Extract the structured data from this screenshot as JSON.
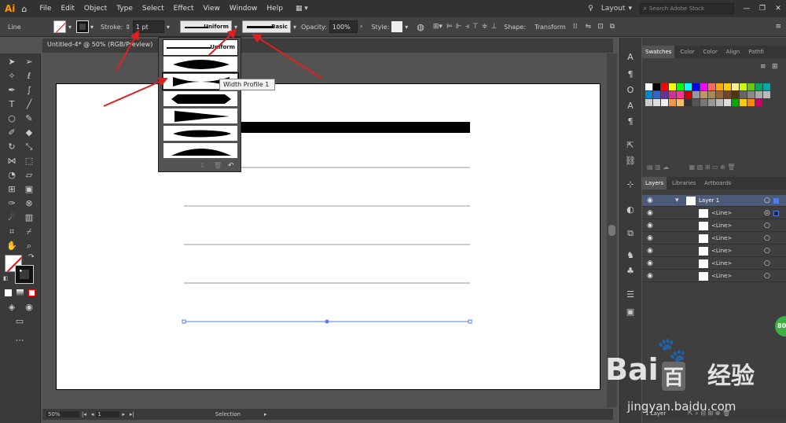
{
  "app": {
    "logo": "Ai"
  },
  "menu": [
    "File",
    "Edit",
    "Object",
    "Type",
    "Select",
    "Effect",
    "View",
    "Window",
    "Help"
  ],
  "topright": {
    "workspace": "Layout",
    "search_placeholder": "Search Adobe Stock"
  },
  "control": {
    "object_type": "Line",
    "stroke_label": "Stroke:",
    "stroke_value": "1 pt",
    "profile_value": "Uniform",
    "brush_value": "Basic",
    "opacity_label": "Opacity:",
    "opacity_value": "100%",
    "style_label": "Style:",
    "shape_label": "Shape:",
    "transform_label": "Transform"
  },
  "document": {
    "tab_title": "Untitled-4* @ 50% (RGB/Preview)"
  },
  "width_profile_menu": {
    "items": [
      "Uniform",
      "",
      "",
      "",
      "",
      "",
      ""
    ],
    "tooltip": "Width Profile 1"
  },
  "status": {
    "zoom": "50%",
    "artboard": "1",
    "mode": "Selection"
  },
  "panel": {
    "tabs": [
      "Swatches",
      "Color",
      "Color",
      "Align",
      "Pathfi"
    ],
    "layer_tabs": [
      "Layers",
      "Libraries",
      "Artboards"
    ],
    "layers": [
      {
        "name": "Layer 1"
      },
      {
        "name": "<Line>"
      },
      {
        "name": "<Line>"
      },
      {
        "name": "<Line>"
      },
      {
        "name": "<Line>"
      },
      {
        "name": "<Line>"
      },
      {
        "name": "<Line>"
      }
    ],
    "footer": "1 Layer"
  },
  "watermark": {
    "brand": "Bai",
    "brand2": "百",
    "cn": "经验",
    "url": "jingyan.baidu.com",
    "badge": "80"
  },
  "colors": {
    "accent": "#ff9a00",
    "selection": "#4f7ee6",
    "arrow": "#e02020"
  }
}
